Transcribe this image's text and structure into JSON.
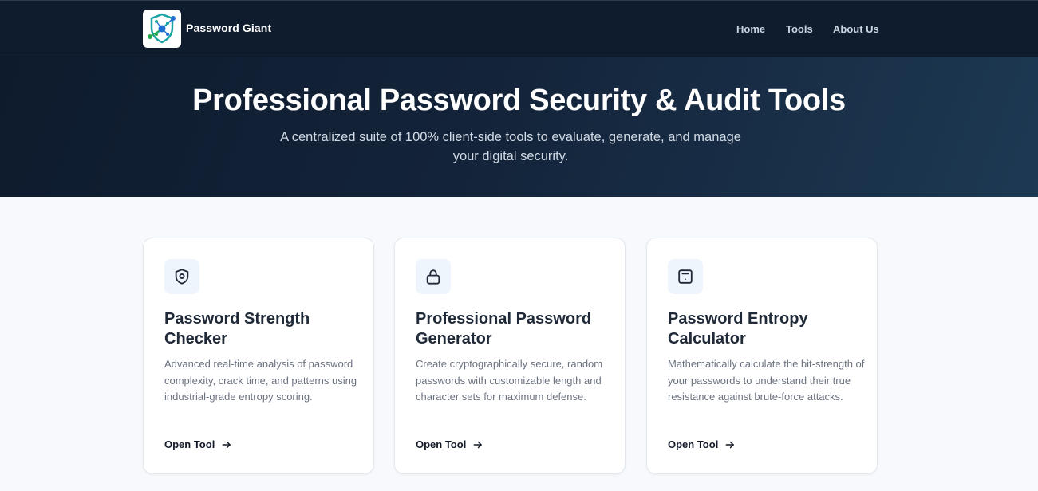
{
  "header": {
    "brand": "Password Giant",
    "logo_icon": "shield-network-logo-icon",
    "nav": {
      "home": "Home",
      "tools": "Tools",
      "about": "About Us"
    }
  },
  "hero": {
    "title": "Professional Password Security & Audit Tools",
    "subtitle": "A centralized suite of 100% client-side tools to evaluate, generate, and manage your digital security."
  },
  "cards": [
    {
      "icon": "shield-icon",
      "title": "Password Strength Checker",
      "description": "Advanced real-time analysis of password complexity, crack time, and patterns using industrial-grade entropy scoring.",
      "link": "Open Tool"
    },
    {
      "icon": "lock-icon",
      "title": "Professional Password Generator",
      "description": "Create cryptographically secure, random passwords with customizable length and character sets for maximum defense.",
      "link": "Open Tool"
    },
    {
      "icon": "calculator-icon",
      "title": "Password Entropy Calculator",
      "description": "Mathematically calculate the bit-strength of your passwords to understand their true resistance against brute-force attacks.",
      "link": "Open Tool"
    }
  ],
  "colors": {
    "header_bg": "#0f1c2e",
    "hero_gradient_end": "#1d3953",
    "page_bg": "#f7f9fc",
    "icon_tile_bg": "#eef5fd",
    "logo_blue": "#1d6fd6",
    "logo_teal": "#1aa3a3",
    "logo_green": "#22a84a"
  }
}
